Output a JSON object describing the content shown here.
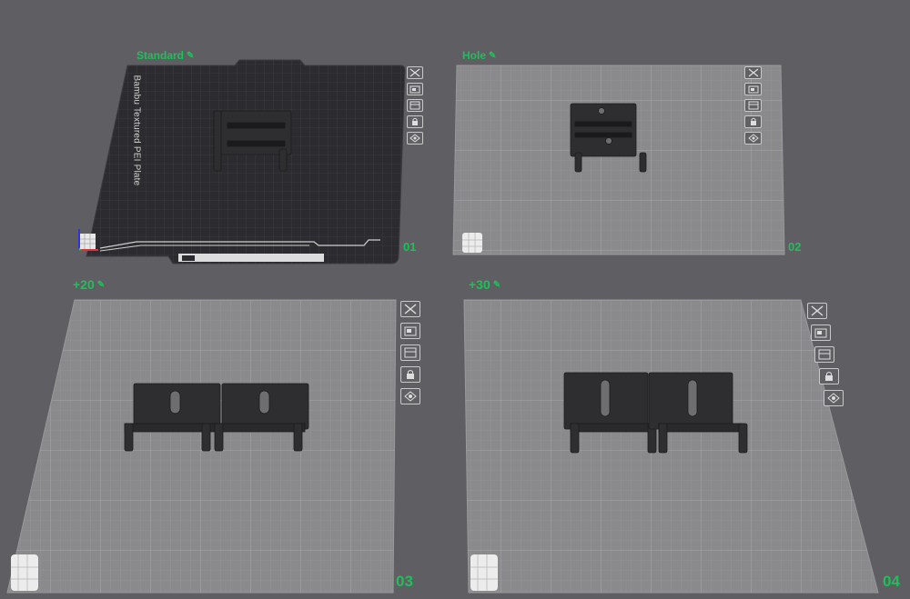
{
  "plates": [
    {
      "name": "Standard",
      "number": "01",
      "bed_label": "Bambu Textured PEI Plate",
      "bed_type": "textured-pei",
      "selected": true
    },
    {
      "name": "Hole",
      "number": "02",
      "bed_type": "generic"
    },
    {
      "name": "+20",
      "number": "03",
      "bed_type": "generic"
    },
    {
      "name": "+30",
      "number": "04",
      "bed_type": "generic"
    }
  ],
  "plate_toolbar": [
    "close-icon",
    "arrange-icon",
    "orient-icon",
    "lock-icon",
    "settings-icon"
  ],
  "colors": {
    "background": "#5f5f63",
    "accent": "#1fbf5a",
    "pei_plate": "#2c2c30",
    "generic_plate": "#8a8a8d",
    "part": "#2e2e30"
  }
}
